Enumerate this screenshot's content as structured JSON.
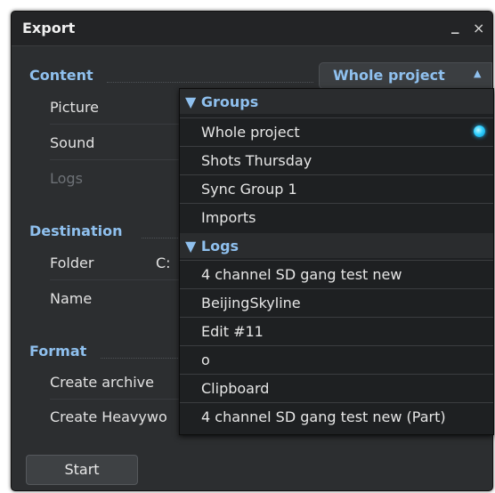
{
  "window": {
    "title": "Export",
    "minimize_glyph": "_",
    "close_glyph": "×"
  },
  "content": {
    "header": "Content",
    "source_select": {
      "value": "Whole project",
      "arrow": "▲"
    },
    "rows": [
      {
        "label": "Picture",
        "enabled": true
      },
      {
        "label": "Sound",
        "enabled": true
      },
      {
        "label": "Logs",
        "enabled": false
      }
    ]
  },
  "destination": {
    "header": "Destination",
    "folder_label": "Folder",
    "folder_value_visible": "C:",
    "name_label": "Name"
  },
  "format": {
    "header": "Format",
    "create_archive_label": "Create archive",
    "create_heavyworks_label_visible": "Create Heavywo"
  },
  "start_button": {
    "label": "Start"
  },
  "menu": {
    "groups": [
      {
        "label": "▼ Groups",
        "items": [
          {
            "label": "Whole project",
            "selected": true
          },
          {
            "label": "Shots Thursday",
            "selected": false
          },
          {
            "label": "Sync Group 1",
            "selected": false
          },
          {
            "label": "Imports",
            "selected": false
          }
        ]
      },
      {
        "label": "▼ Logs",
        "items": [
          {
            "label": "4 channel SD gang test new",
            "selected": false
          },
          {
            "label": "BeijingSkyline",
            "selected": false
          },
          {
            "label": "Edit #11",
            "selected": false
          },
          {
            "label": "o",
            "selected": false
          },
          {
            "label": "Clipboard",
            "selected": false
          },
          {
            "label": "4 channel SD gang test new (Part)",
            "selected": false
          }
        ]
      }
    ]
  },
  "colors": {
    "accent": "#8fc0ee",
    "window_bg": "#2c2e30",
    "menu_bg": "#1e2022",
    "selected_indicator": "#2fd0ff"
  }
}
